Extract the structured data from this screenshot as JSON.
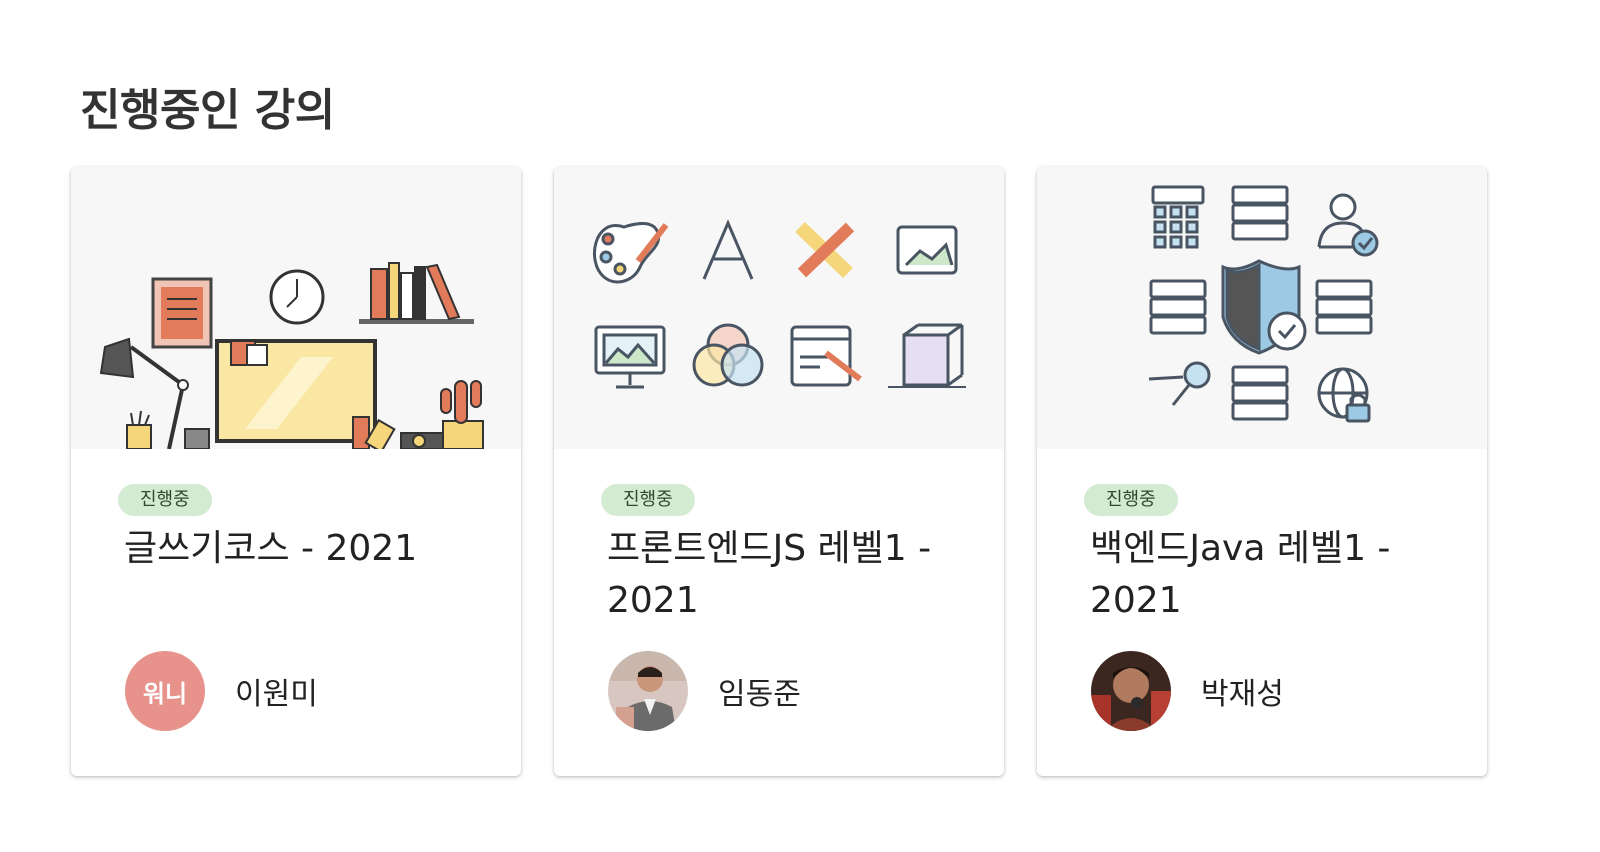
{
  "section": {
    "title": "진행중인 강의"
  },
  "courses": [
    {
      "status": "진행중",
      "title": "글쓰기코스 - 2021",
      "instructor": {
        "name": "이원미",
        "avatar_text": "워니",
        "avatar_color": "#e8928c"
      }
    },
    {
      "status": "진행중",
      "title": "프론트엔드JS 레벨1 - 2021",
      "instructor": {
        "name": "임동준",
        "avatar_text": ""
      }
    },
    {
      "status": "진행중",
      "title": "백엔드Java 레벨1 - 2021",
      "instructor": {
        "name": "박재성",
        "avatar_text": ""
      }
    }
  ],
  "colors": {
    "badge_bg": "#d4ebd3",
    "thumb_bg": "#f7f7f7",
    "avatar_bg": "#e8928c"
  }
}
